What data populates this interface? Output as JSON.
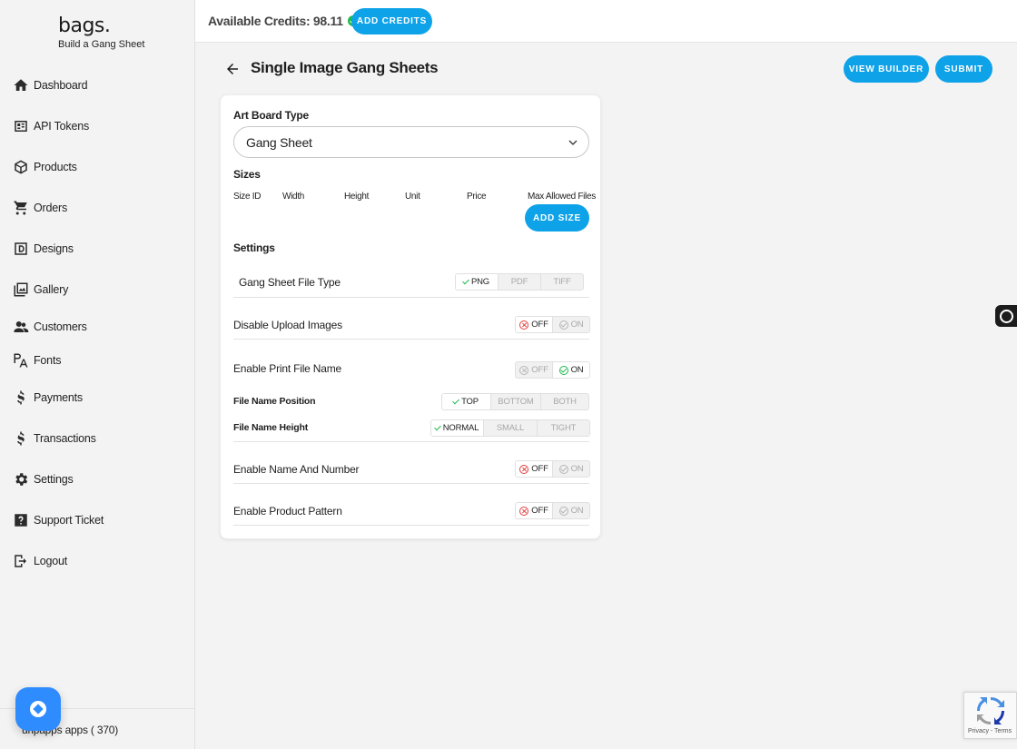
{
  "brand": {
    "name": "bags.",
    "tagline": "Build a Gang Sheet"
  },
  "sidebar": {
    "items": [
      {
        "label": "Dashboard",
        "icon": "home-icon"
      },
      {
        "label": "API Tokens",
        "icon": "token-icon"
      },
      {
        "label": "Products",
        "icon": "box-icon"
      },
      {
        "label": "Orders",
        "icon": "cart-icon"
      },
      {
        "label": "Designs",
        "icon": "designs-icon"
      },
      {
        "label": "Gallery",
        "icon": "gallery-icon"
      },
      {
        "label": "Customers",
        "icon": "users-icon"
      },
      {
        "label": "Fonts",
        "icon": "fonts-icon"
      },
      {
        "label": "Payments",
        "icon": "dollar-icon"
      },
      {
        "label": "Transactions",
        "icon": "dollar-icon"
      },
      {
        "label": "Settings",
        "icon": "gear-icon"
      },
      {
        "label": "Support Ticket",
        "icon": "help-icon"
      },
      {
        "label": "Logout",
        "icon": "logout-icon"
      }
    ],
    "footer": "uripapps apps ( 370)"
  },
  "topbar": {
    "credits_text": "Available Credits: 98.11",
    "add_credits_label": "ADD CREDITS"
  },
  "page": {
    "title": "Single Image Gang Sheets",
    "view_builder_label": "VIEW BUILDER",
    "submit_label": "SUBMIT"
  },
  "form": {
    "art_board_label": "Art Board Type",
    "art_board_value": "Gang Sheet",
    "sizes_label": "Sizes",
    "size_columns": [
      "Size ID",
      "Width",
      "Height",
      "Unit",
      "Price",
      "Max Allowed Files"
    ],
    "add_size_label": "ADD SIZE",
    "settings_label": "Settings",
    "file_type": {
      "label": "Gang Sheet File Type",
      "options": [
        "PNG",
        "PDF",
        "TIFF"
      ],
      "selected": "PNG"
    },
    "disable_upload": {
      "label": "Disable Upload Images",
      "off": "OFF",
      "on": "ON",
      "selected": "OFF"
    },
    "print_file_name": {
      "label": "Enable Print File Name",
      "off": "OFF",
      "on": "ON",
      "selected": "ON"
    },
    "file_name_position": {
      "label": "File Name Position",
      "options": [
        "TOP",
        "BOTTOM",
        "BOTH"
      ],
      "selected": "TOP"
    },
    "file_name_height": {
      "label": "File Name Height",
      "options": [
        "NORMAL",
        "SMALL",
        "TIGHT"
      ],
      "selected": "NORMAL"
    },
    "name_and_number": {
      "label": "Enable Name And Number",
      "off": "OFF",
      "on": "ON",
      "selected": "OFF"
    },
    "product_pattern": {
      "label": "Enable Product Pattern",
      "off": "OFF",
      "on": "ON",
      "selected": "OFF"
    }
  },
  "recaptcha": {
    "links": "Privacy - Terms"
  },
  "colors": {
    "accent": "#0ea2e8",
    "success": "#1fba4e",
    "danger": "#e43d3d"
  }
}
